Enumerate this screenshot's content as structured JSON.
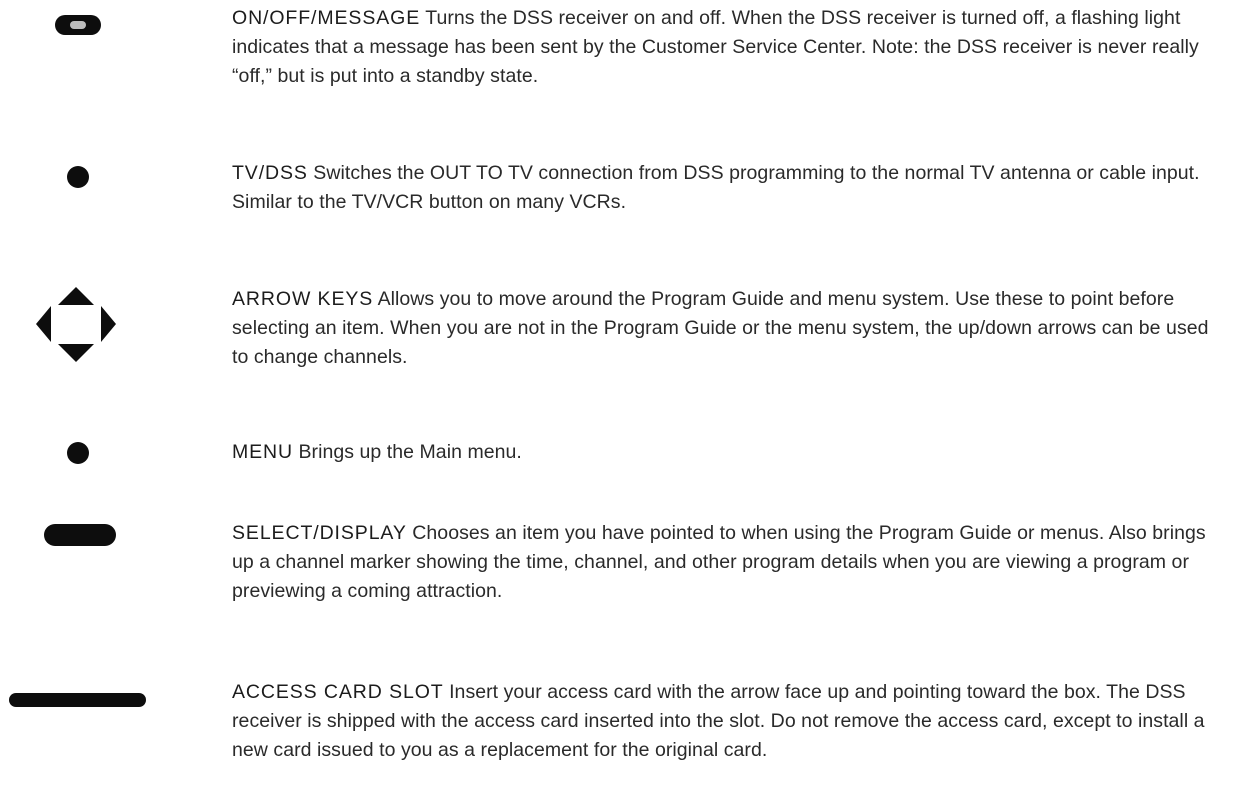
{
  "entries": [
    {
      "term": "ON/OFF/MESSAGE",
      "text": " Turns the DSS receiver on and off. When the DSS receiver is turned off, a flashing light indicates that a message has been sent by the Customer Service Center. Note: the DSS receiver is never really “off,” but is put into a standby state.",
      "icon": "on-off-button-icon"
    },
    {
      "term": "TV/DSS",
      "text": " Switches the OUT TO TV connection from DSS programming to the normal TV antenna or cable input. Similar to the TV/VCR button on many VCRs.",
      "icon": "round-button-icon"
    },
    {
      "term": "ARROW KEYS",
      "text": " Allows you to move around the Program Guide and menu system. Use these to point before selecting an item. When you are not in the Program Guide or the menu system, the up/down arrows can be used to change channels.",
      "icon": "arrow-keys-icon"
    },
    {
      "term": "MENU",
      "text": " Brings up the Main menu.",
      "icon": "round-button-icon"
    },
    {
      "term": "SELECT/DISPLAY",
      "text": " Chooses an item you have pointed to when using the Program Guide or menus. Also brings up a channel marker showing the time, channel, and other program details when you are viewing a program or previewing a coming attraction.",
      "icon": "oval-button-icon"
    },
    {
      "term": "ACCESS CARD SLOT",
      "text": " Insert your access card with the arrow face up and pointing toward the box. The DSS receiver is shipped with the access card inserted into the slot. Do not remove the access card, except to install a new card issued to you as a replacement for the original card.",
      "icon": "card-slot-icon"
    }
  ]
}
